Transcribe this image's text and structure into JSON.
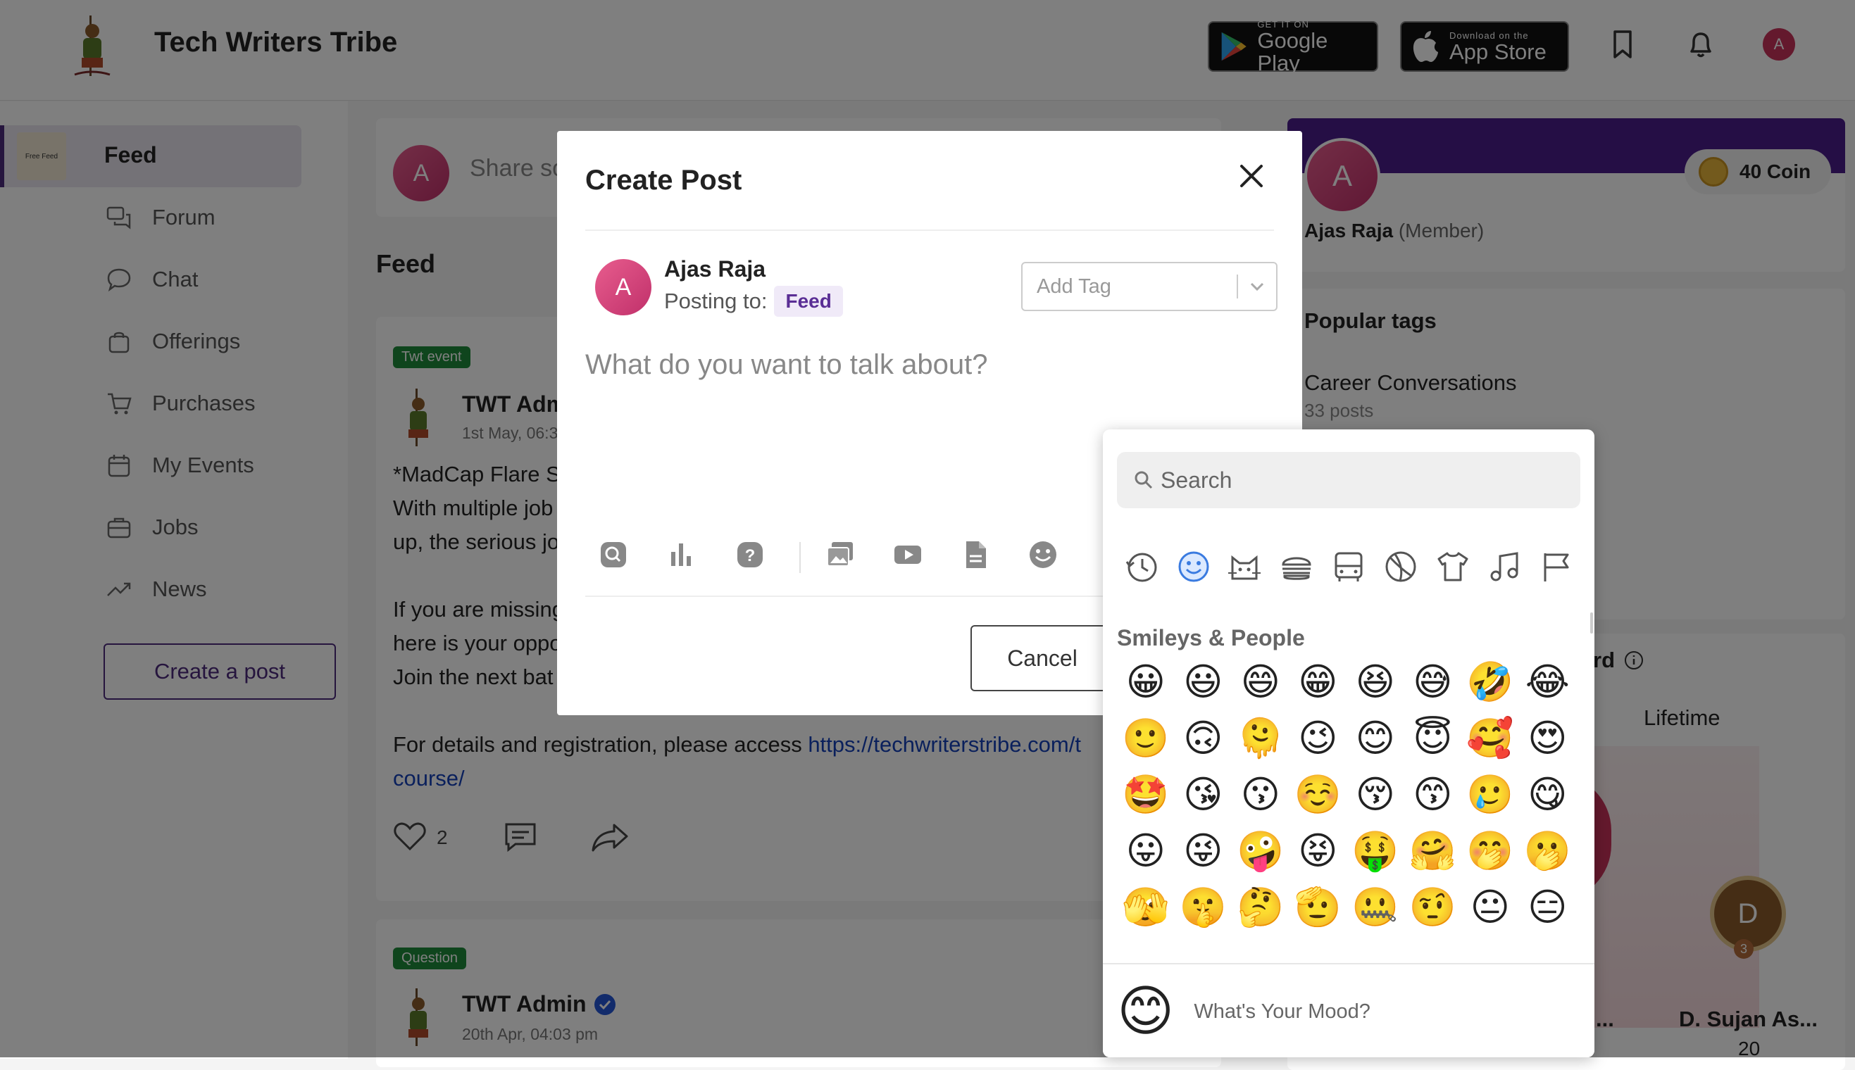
{
  "header": {
    "title": "Tech Writers Tribe",
    "google_small": "GET IT ON",
    "google_big": "Google Play",
    "apple_small": "Download on the",
    "apple_big": "App Store",
    "avatar_letter": "A"
  },
  "sidebar": {
    "items": [
      {
        "label": "Feed",
        "icon": "feed-thumb"
      },
      {
        "label": "Forum",
        "icon": "forum-icon"
      },
      {
        "label": "Chat",
        "icon": "chat-icon"
      },
      {
        "label": "Offerings",
        "icon": "bag-icon"
      },
      {
        "label": "Purchases",
        "icon": "cart-icon"
      },
      {
        "label": "My Events",
        "icon": "calendar-icon"
      },
      {
        "label": "Jobs",
        "icon": "briefcase-icon"
      },
      {
        "label": "News",
        "icon": "trend-icon"
      }
    ],
    "feed_thumb_text": "Free Feed",
    "create_post": "Create a post"
  },
  "feed": {
    "share_avatar": "A",
    "share_placeholder": "Share so",
    "heading": "Feed",
    "post1": {
      "badge": "Twt event",
      "author": "TWT Adm",
      "date": "1st May, 06:3",
      "lines": [
        "*MadCap Flare S",
        "With multiple job",
        "up, the serious jo",
        "",
        "If you are missing",
        "here is your oppo",
        "Join the next bat"
      ],
      "details_text": "For details and registration, please access ",
      "link1": "https://techwriterstribe.com/t",
      "link2": "course/",
      "likes": "2"
    },
    "post2": {
      "badge": "Question",
      "author": "TWT Admin",
      "date": "20th Apr, 04:03 pm"
    }
  },
  "right": {
    "avatar_letter": "A",
    "coins": "40 Coin",
    "user_name": "Ajas Raja",
    "user_role": "(Member)",
    "popular_tags_title": "Popular tags",
    "tag_name": "Career Conversations",
    "tag_count": "33 posts",
    "leaderboard_title_fragment": "rd",
    "lifetime_tab": "Lifetime",
    "leader_letter": "D",
    "leader_rank": "3",
    "leader_name": "D. Sujan As...",
    "leader_score": "20",
    "other_name": "..."
  },
  "modal": {
    "title": "Create Post",
    "author_letter": "A",
    "author_name": "Ajas Raja",
    "posting_to_label": "Posting to:",
    "posting_to_value": "Feed",
    "tag_placeholder": "Add Tag",
    "body_placeholder": "What do you want to talk about?",
    "cancel": "Cancel",
    "toolbar_icons": [
      "qa-icon",
      "poll-icon",
      "question-icon",
      "gallery-icon",
      "video-icon",
      "document-icon",
      "emoji-icon"
    ]
  },
  "emoji_picker": {
    "search_placeholder": "Search",
    "section": "Smileys & People",
    "categories": [
      "recent-icon",
      "smiley-icon",
      "animal-icon",
      "food-icon",
      "travel-icon",
      "activity-icon",
      "clothing-icon",
      "music-icon",
      "flag-icon"
    ],
    "emojis": [
      "😀",
      "😃",
      "😄",
      "😁",
      "😆",
      "😅",
      "🤣",
      "😂",
      "🙂",
      "🙃",
      "🫠",
      "😉",
      "😊",
      "😇",
      "🥰",
      "😍",
      "🤩",
      "😘",
      "😗",
      "☺️",
      "😚",
      "😙",
      "🥲",
      "😋",
      "😛",
      "😜",
      "🤪",
      "😝",
      "🤑",
      "🤗",
      "🤭",
      "🫢",
      "🫣",
      "🤫",
      "🤔",
      "🫡",
      "🤐",
      "🤨",
      "😐",
      "😑"
    ],
    "footer_emoji": "😊",
    "footer_text": "What's Your Mood?"
  }
}
